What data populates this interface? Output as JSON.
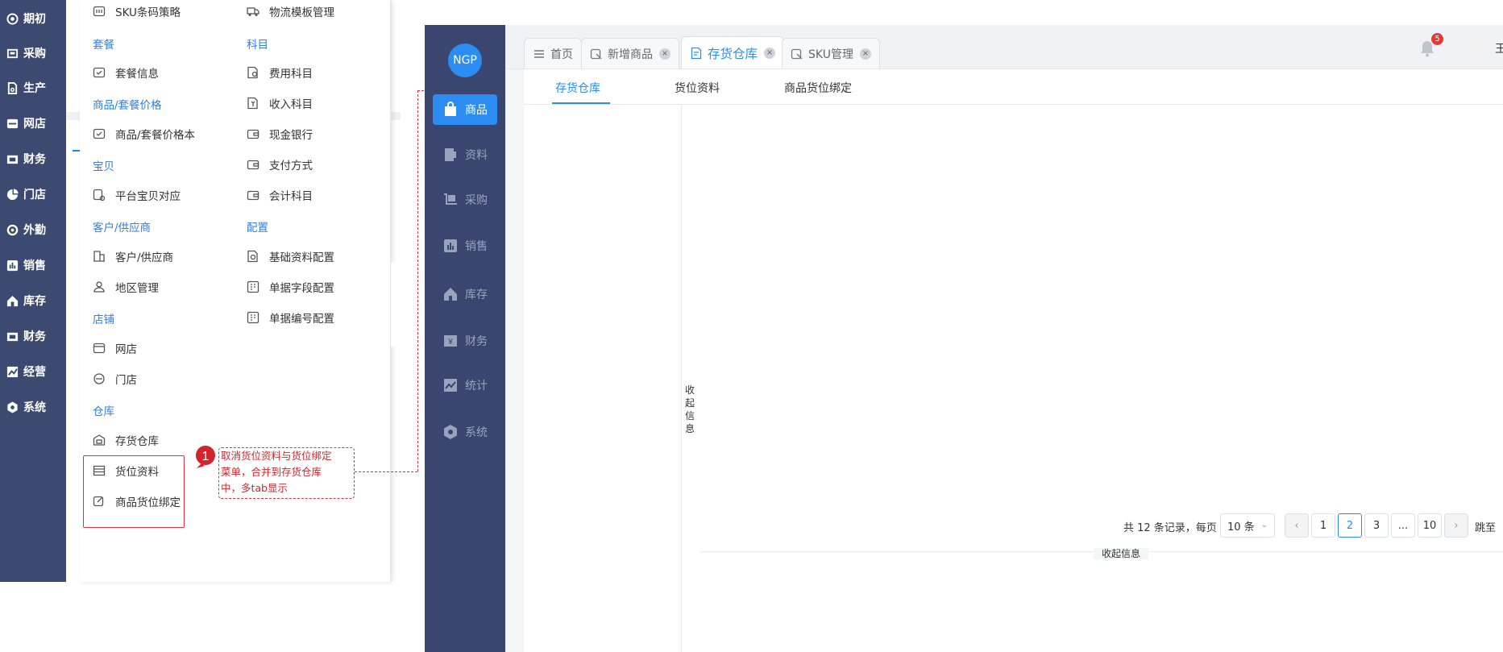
{
  "left_sidebar": {
    "items": [
      {
        "label": "期初",
        "icon": "target-icon"
      },
      {
        "label": "采购",
        "icon": "truck-icon"
      },
      {
        "label": "生产",
        "icon": "document-icon"
      },
      {
        "label": "网店",
        "icon": "shop-icon"
      },
      {
        "label": "财务",
        "icon": "wallet-icon"
      },
      {
        "label": "门店",
        "icon": "pie-icon"
      },
      {
        "label": "外勤",
        "icon": "refresh-icon"
      },
      {
        "label": "销售",
        "icon": "bar-chart-icon"
      },
      {
        "label": "库存",
        "icon": "home-icon"
      },
      {
        "label": "财务",
        "icon": "wallet-icon"
      },
      {
        "label": "经营",
        "icon": "line-chart-icon"
      },
      {
        "label": "系统",
        "icon": "gear-icon"
      }
    ]
  },
  "menu": {
    "col1_items": {
      "sku": "SKU条码策略",
      "package_info": "套餐信息",
      "price_book": "商品/套餐价格本",
      "platform_map": "平台宝贝对应",
      "customer_supplier": "客户/供应商",
      "region": "地区管理",
      "online_store": "网店",
      "store": "门店",
      "warehouse": "存货仓库",
      "location_data": "货位资料",
      "product_location_binding": "商品货位绑定"
    },
    "col1_heads": {
      "package": "套餐",
      "price": "商品/套餐价格",
      "baby": "宝贝",
      "customer": "客户/供应商",
      "shop": "店铺",
      "warehouse": "仓库"
    },
    "col2_items": {
      "logistics_template": "物流模板管理",
      "expense_account": "费用科目",
      "income_account": "收入科目",
      "cash_bank": "现金银行",
      "payment_method": "支付方式",
      "accounting_subject": "会计科目",
      "basic_config": "基础资料配置",
      "field_config": "单据字段配置",
      "number_config": "单据编号配置"
    },
    "col2_heads": {
      "subject": "科目",
      "config": "配置"
    }
  },
  "annotation": {
    "number": "1",
    "text_line1": "取消货位资料与货位绑定",
    "text_line2": "菜单，合并到存货仓库",
    "text_line3": "中，多tab显示"
  },
  "nav2": {
    "logo": "NGP",
    "items": [
      {
        "label": "商品",
        "icon": "bag-icon"
      },
      {
        "label": "资料",
        "icon": "file-icon"
      },
      {
        "label": "采购",
        "icon": "cart-icon"
      },
      {
        "label": "销售",
        "icon": "chart-icon"
      },
      {
        "label": "库存",
        "icon": "house-icon"
      },
      {
        "label": "财务",
        "icon": "yen-icon"
      },
      {
        "label": "统计",
        "icon": "stats-icon"
      },
      {
        "label": "系统",
        "icon": "gear-icon"
      }
    ]
  },
  "tabs": {
    "home": "首页",
    "new_product": "新增商品",
    "warehouse": "存货仓库",
    "sku": "SKU管理",
    "close": "×"
  },
  "header": {
    "badge": "5",
    "username": "王"
  },
  "subtabs": {
    "warehouse": "存货仓库",
    "location": "货位资料",
    "binding": "商品货位绑定"
  },
  "side_collapse": "收起信息",
  "pagination": {
    "total": "共 12 条记录，每页",
    "page_size": "10 条",
    "pages": [
      "1",
      "2",
      "3",
      "...",
      "10"
    ],
    "current": "2",
    "prev": "‹",
    "next": "›",
    "jump": "跳至"
  },
  "bottom_collapse": "收起信息",
  "colors": {
    "accent": "#2b8cf2",
    "sidebar": "#3c4a72",
    "annotation_red": "#e0303a"
  }
}
